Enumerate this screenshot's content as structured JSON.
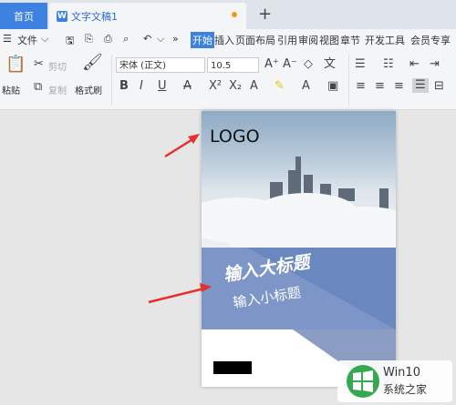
{
  "tabs": {
    "home": "首页",
    "doc": "文字文稿1",
    "new_tab": "+"
  },
  "menu": {
    "file": "文件",
    "items": [
      "开始",
      "插入",
      "页面布局",
      "引用",
      "审阅",
      "视图",
      "章节",
      "开发工具",
      "会员专享"
    ],
    "more": "»"
  },
  "ribbon": {
    "paste": "粘贴",
    "cut": "剪切",
    "copy": "复制",
    "format_painter": "格式刷",
    "font_name": "宋体 (正文)",
    "font_size": "10.5"
  },
  "page": {
    "logo": "LOGO",
    "title": "输入大标题",
    "subtitle": "输入小标题",
    "band_color": "#6a88bf"
  },
  "watermark": {
    "line1": "Win10",
    "line2": "系统之家"
  },
  "colors": {
    "accent": "#3d82e0",
    "arrow": "#e63030",
    "band": "#6a88bf"
  }
}
